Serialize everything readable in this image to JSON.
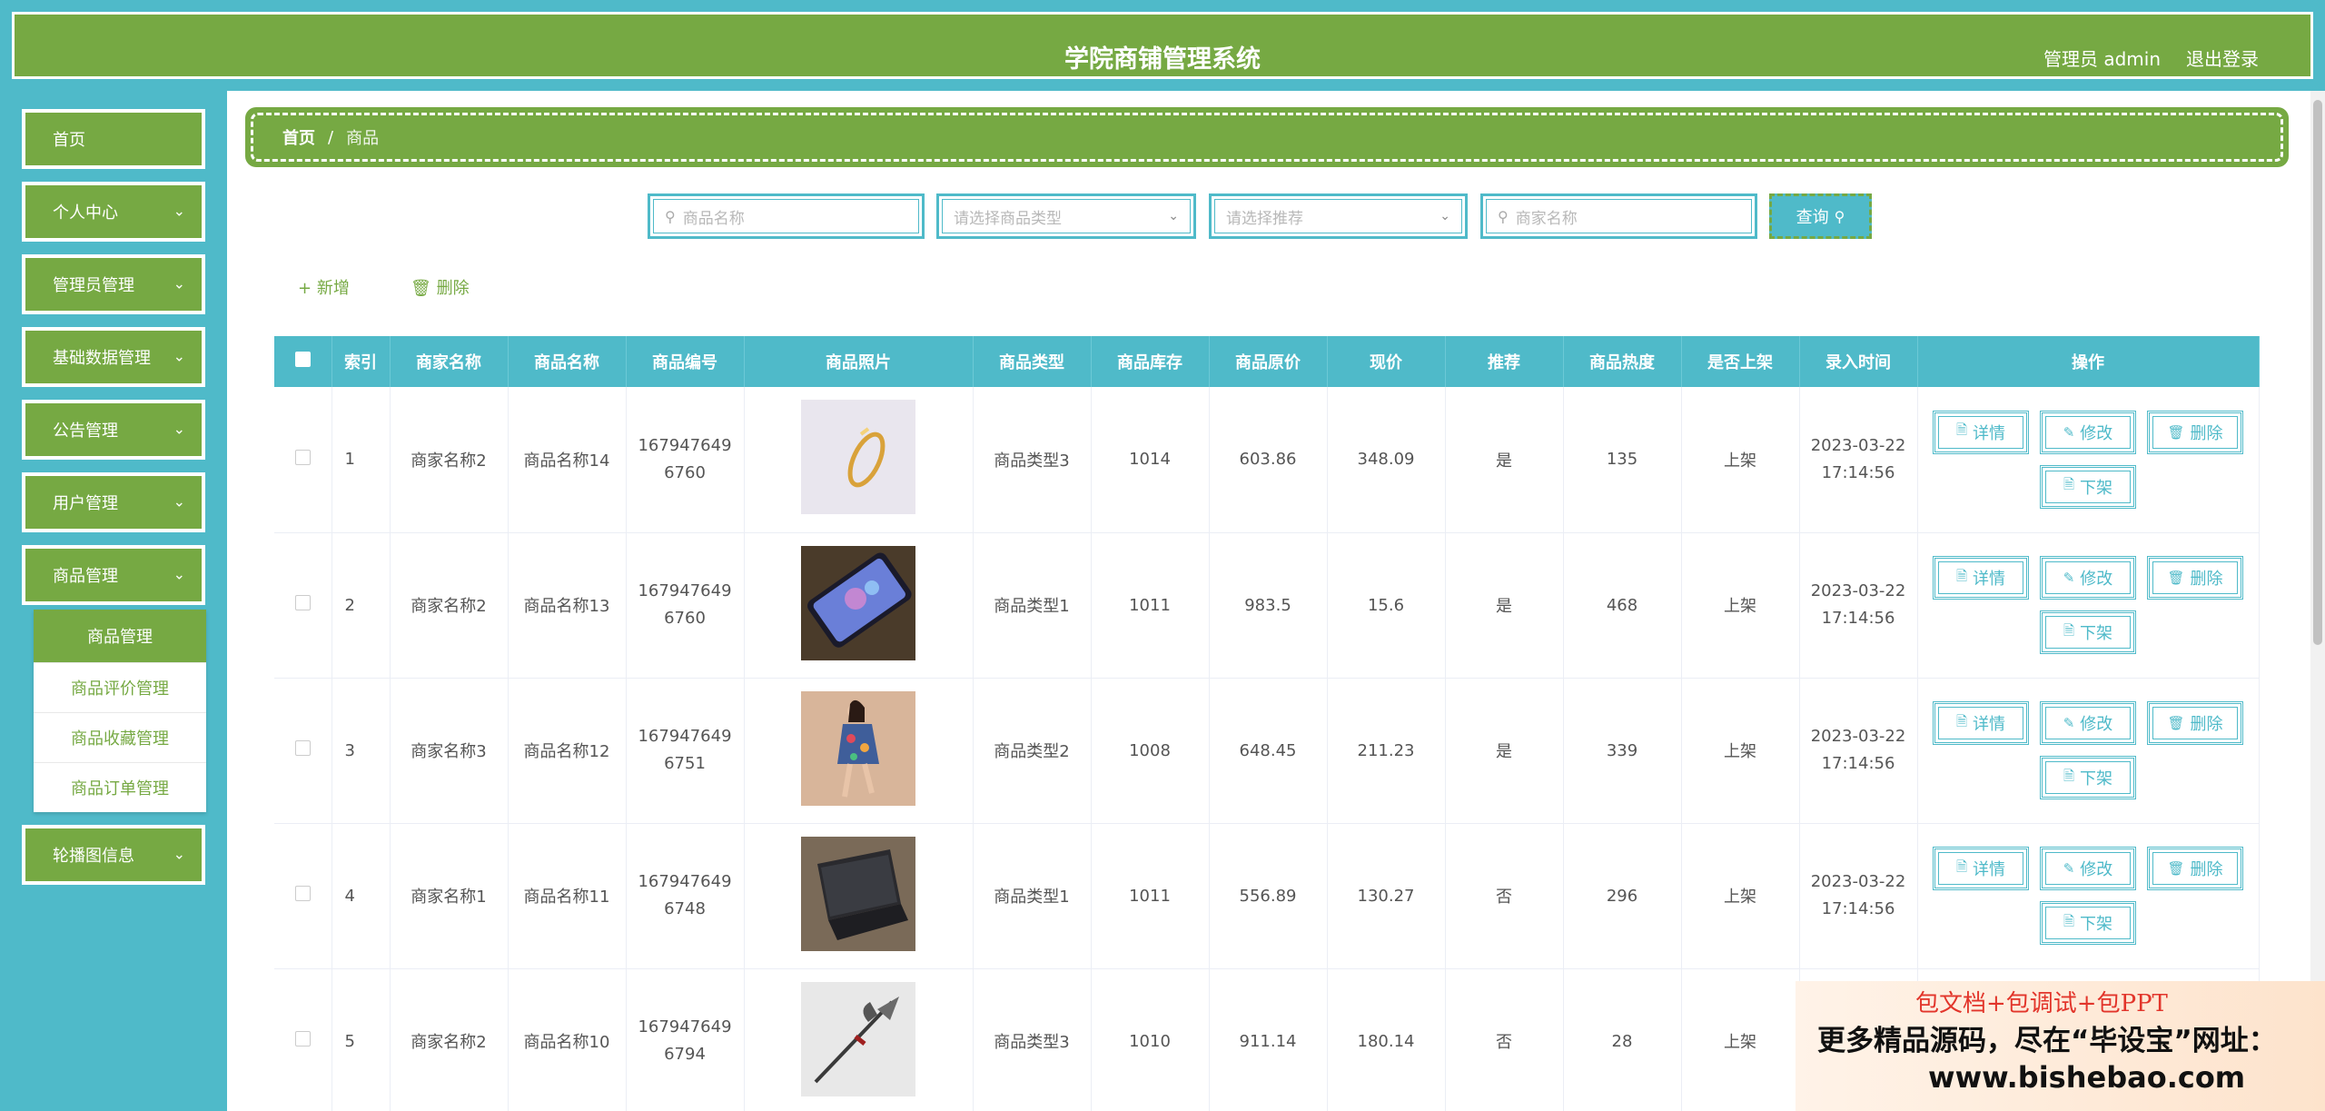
{
  "header": {
    "title": "学院商铺管理系统",
    "user": "管理员 admin",
    "logout": "退出登录"
  },
  "sidebar": {
    "items": [
      {
        "label": "首页"
      },
      {
        "label": "个人中心"
      },
      {
        "label": "管理员管理"
      },
      {
        "label": "基础数据管理"
      },
      {
        "label": "公告管理"
      },
      {
        "label": "用户管理"
      },
      {
        "label": "商品管理"
      },
      {
        "label": "轮播图信息"
      }
    ],
    "submenu": {
      "active": "商品管理",
      "items": [
        "商品评价管理",
        "商品收藏管理",
        "商品订单管理"
      ]
    }
  },
  "breadcrumb": {
    "home": "首页",
    "separator": "/",
    "current": "商品"
  },
  "search": {
    "name_placeholder": "商品名称",
    "type_placeholder": "请选择商品类型",
    "recommend_placeholder": "请选择推荐",
    "merchant_placeholder": "商家名称",
    "query_label": "查询"
  },
  "actions": {
    "add": "新增",
    "delete": "删除"
  },
  "table": {
    "headers": [
      "索引",
      "商家名称",
      "商品名称",
      "商品编号",
      "商品照片",
      "商品类型",
      "商品库存",
      "商品原价",
      "现价",
      "推荐",
      "商品热度",
      "是否上架",
      "录入时间",
      "操作"
    ],
    "rows": [
      {
        "idx": "1",
        "merchant": "商家名称2",
        "name": "商品名称14",
        "code": "1679476496760",
        "type": "商品类型3",
        "stock": "1014",
        "orig": "603.86",
        "price": "348.09",
        "rec": "是",
        "heat": "135",
        "status": "上架",
        "date": "2023-03-22",
        "time": "17:14:56",
        "photo": "ring"
      },
      {
        "idx": "2",
        "merchant": "商家名称2",
        "name": "商品名称13",
        "code": "1679476496760",
        "type": "商品类型1",
        "stock": "1011",
        "orig": "983.5",
        "price": "15.6",
        "rec": "是",
        "heat": "468",
        "status": "上架",
        "date": "2023-03-22",
        "time": "17:14:56",
        "photo": "phone"
      },
      {
        "idx": "3",
        "merchant": "商家名称3",
        "name": "商品名称12",
        "code": "1679476496751",
        "type": "商品类型2",
        "stock": "1008",
        "orig": "648.45",
        "price": "211.23",
        "rec": "是",
        "heat": "339",
        "status": "上架",
        "date": "2023-03-22",
        "time": "17:14:56",
        "photo": "dress"
      },
      {
        "idx": "4",
        "merchant": "商家名称1",
        "name": "商品名称11",
        "code": "1679476496748",
        "type": "商品类型1",
        "stock": "1011",
        "orig": "556.89",
        "price": "130.27",
        "rec": "否",
        "heat": "296",
        "status": "上架",
        "date": "2023-03-22",
        "time": "17:14:56",
        "photo": "laptop"
      },
      {
        "idx": "5",
        "merchant": "商家名称2",
        "name": "商品名称10",
        "code": "1679476496794",
        "type": "商品类型3",
        "stock": "1010",
        "orig": "911.14",
        "price": "180.14",
        "rec": "否",
        "heat": "28",
        "status": "上架",
        "date": "",
        "time": "",
        "photo": "halberd"
      }
    ],
    "ops": {
      "detail": "详情",
      "edit": "修改",
      "delete": "删除",
      "offshelf": "下架"
    }
  },
  "watermark": {
    "line1": "包文档+包调试+包PPT",
    "line2": "更多精品源码，尽在“毕设宝”网址：",
    "line3": "www.bishebao.com"
  },
  "colors": {
    "green": "#76a943",
    "teal": "#4fbac9"
  }
}
